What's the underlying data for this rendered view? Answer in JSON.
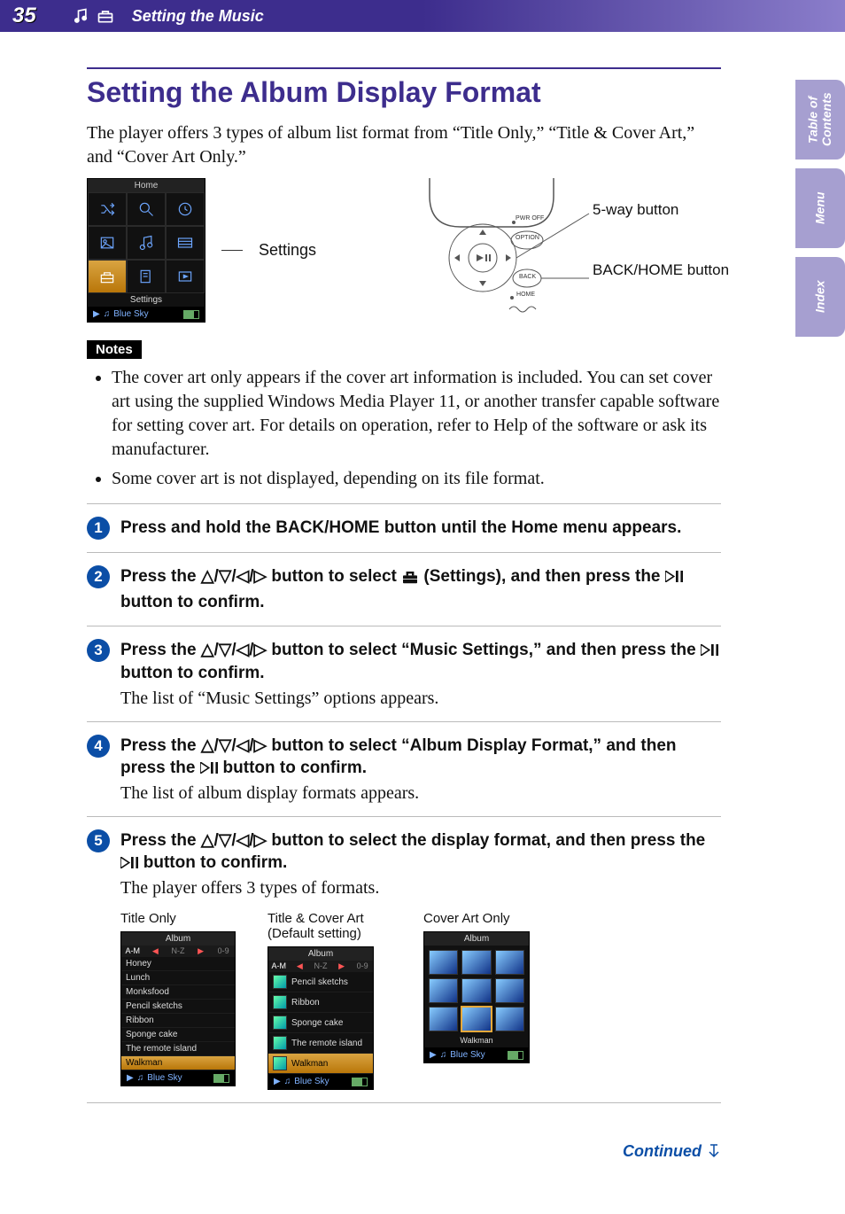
{
  "header": {
    "page_number": "35",
    "section_title": "Setting the Music"
  },
  "side_tabs": [
    "Table of\nContents",
    "Menu",
    "Index"
  ],
  "title": "Setting the Album Display Format",
  "intro": "The player offers 3 types of album list format from “Title Only,” “Title & Cover Art,” and “Cover Art Only.”",
  "home_screenshot": {
    "title": "Home",
    "selected_label": "Settings",
    "now_playing": "Blue Sky"
  },
  "figure_labels": {
    "settings": "Settings",
    "five_way": "5-way button",
    "back_home": "BACK/HOME button"
  },
  "device_diagram": {
    "pwr_off": "PWR OFF",
    "option": "OPTION",
    "back": "BACK",
    "home": "HOME"
  },
  "notes_label": "Notes",
  "notes": [
    "The cover art only appears if the cover art information is included. You can set cover art using the supplied Windows Media Player 11, or another transfer capable software for setting cover art. For details on operation, refer to Help of the software or ask its manufacturer.",
    "Some cover art is not displayed, depending on its file format."
  ],
  "steps": [
    {
      "lead_before": "Press and hold the BACK/HOME button until the Home menu appears.",
      "desc": ""
    },
    {
      "lead_before": "Press the ",
      "lead_mid": " button to select ",
      "lead_after": " (Settings), and then press the ",
      "lead_end": " button to confirm.",
      "desc": ""
    },
    {
      "lead_before": "Press the ",
      "lead_mid": " button to select “Music Settings,” and then press the ",
      "lead_end": " button to confirm.",
      "desc": "The list of “Music Settings” options appears."
    },
    {
      "lead_before": "Press the ",
      "lead_mid": " button to select “Album Display Format,” and then press the ",
      "lead_end": " button to confirm.",
      "desc": "The list of album display formats appears."
    },
    {
      "lead_before": "Press the ",
      "lead_mid": " button to select the display format, and then press the ",
      "lead_end": " button to confirm.",
      "desc": "The player offers 3 types of formats."
    }
  ],
  "dpad_symbols": "△/▽/◁/▷",
  "formats": {
    "captions": {
      "title_only": "Title Only",
      "title_cover": "Title & Cover Art (Default setting)",
      "cover_only": "Cover Art Only"
    },
    "album_header": "Album",
    "index_tabs": {
      "am": "A-M",
      "nz": "N-Z",
      "num": "0-9"
    },
    "title_only_list": [
      "Honey",
      "Lunch",
      "Monksfood",
      "Pencil sketchs",
      "Ribbon",
      "Sponge cake",
      "The remote island",
      "Walkman"
    ],
    "title_cover_list": [
      "Pencil sketchs",
      "Ribbon",
      "Sponge cake",
      "The remote island",
      "Walkman"
    ],
    "cover_only_selected_label": "Walkman",
    "now_playing": "Blue Sky"
  },
  "continued": "Continued"
}
